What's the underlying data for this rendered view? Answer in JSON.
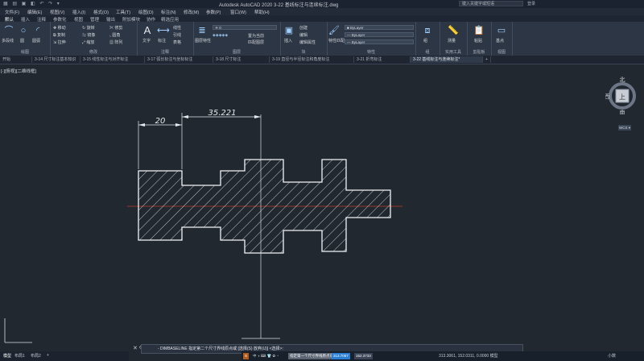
{
  "window": {
    "title": "Autodesk AutoCAD 2020    3-22 基线标注与连续标注.dwg",
    "search_placeholder": "键入关键字或短语",
    "user": "登录"
  },
  "menus": [
    "文件(F)",
    "编辑(E)",
    "视图(V)",
    "插入(I)",
    "格式(O)",
    "工具(T)",
    "绘图(D)",
    "标注(N)",
    "修改(M)",
    "参数(P)",
    "窗口(W)",
    "帮助(H)"
  ],
  "ribbon_tabs": [
    "默认",
    "插入",
    "注释",
    "参数化",
    "视图",
    "管理",
    "输出",
    "附加模块",
    "协作",
    "精选应用"
  ],
  "ribbon": {
    "draw": {
      "label": "绘图",
      "tools": [
        "多段线",
        "圆",
        "圆弧"
      ]
    },
    "modify": {
      "label": "修改",
      "tools": [
        "移动",
        "旋转",
        "修剪",
        "复制",
        "镜像",
        "圆角",
        "拉伸",
        "缩放",
        "阵列"
      ]
    },
    "annotation": {
      "label": "注释",
      "tools": [
        "文字",
        "标注",
        "线性",
        "引线",
        "表格"
      ]
    },
    "layers": {
      "label": "图层",
      "tools": [
        "图层特性",
        "置为当前",
        "匹配图层"
      ],
      "current": "0"
    },
    "block": {
      "label": "块",
      "tools": [
        "插入",
        "创建",
        "编辑",
        "编辑属性"
      ]
    },
    "properties": {
      "label": "特性",
      "tools": [
        "特性匹配"
      ],
      "color": "ByLayer",
      "linetype": "ByLayer",
      "lineweight": "ByLayer"
    },
    "groups": {
      "label": "组",
      "tools": [
        "组"
      ]
    },
    "utilities": {
      "label": "实用工具",
      "tools": [
        "测量"
      ]
    },
    "clipboard": {
      "label": "剪贴板",
      "tools": [
        "粘贴"
      ]
    },
    "view": {
      "label": "视图",
      "tools": [
        "基点"
      ]
    }
  },
  "doc_tabs": [
    {
      "label": "开始"
    },
    {
      "label": "3-14 尺寸标注基本知识"
    },
    {
      "label": "3-15 线性标注与对齐标注"
    },
    {
      "label": "3-17 弧长标注与坐标标注"
    },
    {
      "label": "3-18 尺寸标注"
    },
    {
      "label": "3-19 直径与半径标注和角度标注"
    },
    {
      "label": "3-21 折弯标注"
    },
    {
      "label": "3-22 基线标注与连续标注*"
    }
  ],
  "viewport_label": "[-][俯视][二维线框]",
  "viewcube": {
    "north": "北",
    "south": "南",
    "west": "西",
    "east": "东",
    "top": "上"
  },
  "wcs": "WCS",
  "drawing": {
    "dim1": "20",
    "dim2": "35.221"
  },
  "layout_tabs": [
    "模型",
    "布局1",
    "布局2"
  ],
  "command_line": "- DIMBASELINE 指定第二个尺寸界线原点或 [选择(S) 放弃(U)] <选择>:",
  "taskbar_inputs": [
    "指定第一个尺寸界线原点或",
    "313.7067",
    "152.3733"
  ],
  "coords": "313.3061, 152.0311, 0.0000  模型",
  "status": "小数",
  "colors": {
    "accent": "#2a7fd4",
    "centerline": "#c0392b",
    "bg": "#212830"
  }
}
